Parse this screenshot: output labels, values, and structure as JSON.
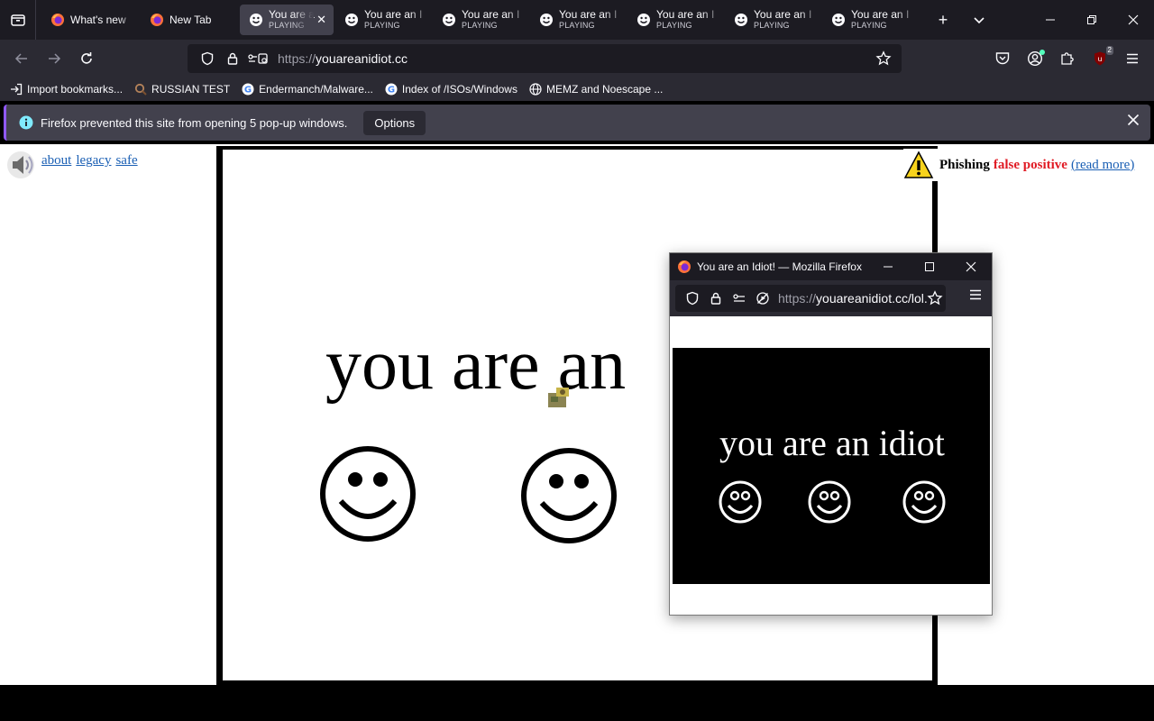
{
  "tabs": [
    {
      "title": "What's new",
      "icon": "firefox-icon"
    },
    {
      "title": "New Tab",
      "icon": "firefox-icon"
    },
    {
      "title": "You are a",
      "sub": "PLAYING",
      "active": true
    },
    {
      "title": "You are an I",
      "sub": "PLAYING"
    },
    {
      "title": "You are an I",
      "sub": "PLAYING"
    },
    {
      "title": "You are an I",
      "sub": "PLAYING"
    },
    {
      "title": "You are an I",
      "sub": "PLAYING"
    },
    {
      "title": "You are an I",
      "sub": "PLAYING"
    },
    {
      "title": "You are an I",
      "sub": "PLAYING"
    }
  ],
  "navbar": {
    "url_scheme": "https://",
    "url_host": "youareanidiot.cc"
  },
  "extensions": {
    "ublock_badge": "2"
  },
  "bookmarks": [
    {
      "label": "Import bookmarks...",
      "icon": "import-icon"
    },
    {
      "label": "RUSSIAN TEST",
      "icon": "search-icon"
    },
    {
      "label": "Endermanch/Malware...",
      "icon": "google-icon"
    },
    {
      "label": "Index of /ISOs/Windows",
      "icon": "google-icon"
    },
    {
      "label": "MEMZ and Noescape ...",
      "icon": "globe-icon"
    }
  ],
  "notification": {
    "message": "Firefox prevented this site from opening 5 pop-up windows.",
    "options_label": "Options"
  },
  "page": {
    "links": [
      "about",
      "legacy",
      "safe"
    ],
    "big_text": "you are an",
    "phishing": {
      "word1": "Phishing",
      "word2": "false positive",
      "link": "(read more)"
    }
  },
  "popup": {
    "title": "You are an Idiot! — Mozilla Firefox",
    "url_scheme": "https://",
    "url_rest": "youareanidiot.cc/lol.",
    "text": "you are an idiot"
  },
  "colors": {
    "tabstrip": "#1c1b22",
    "toolbar": "#2b2a33",
    "link": "#1a5fb4",
    "warning_red": "#e01b24"
  }
}
